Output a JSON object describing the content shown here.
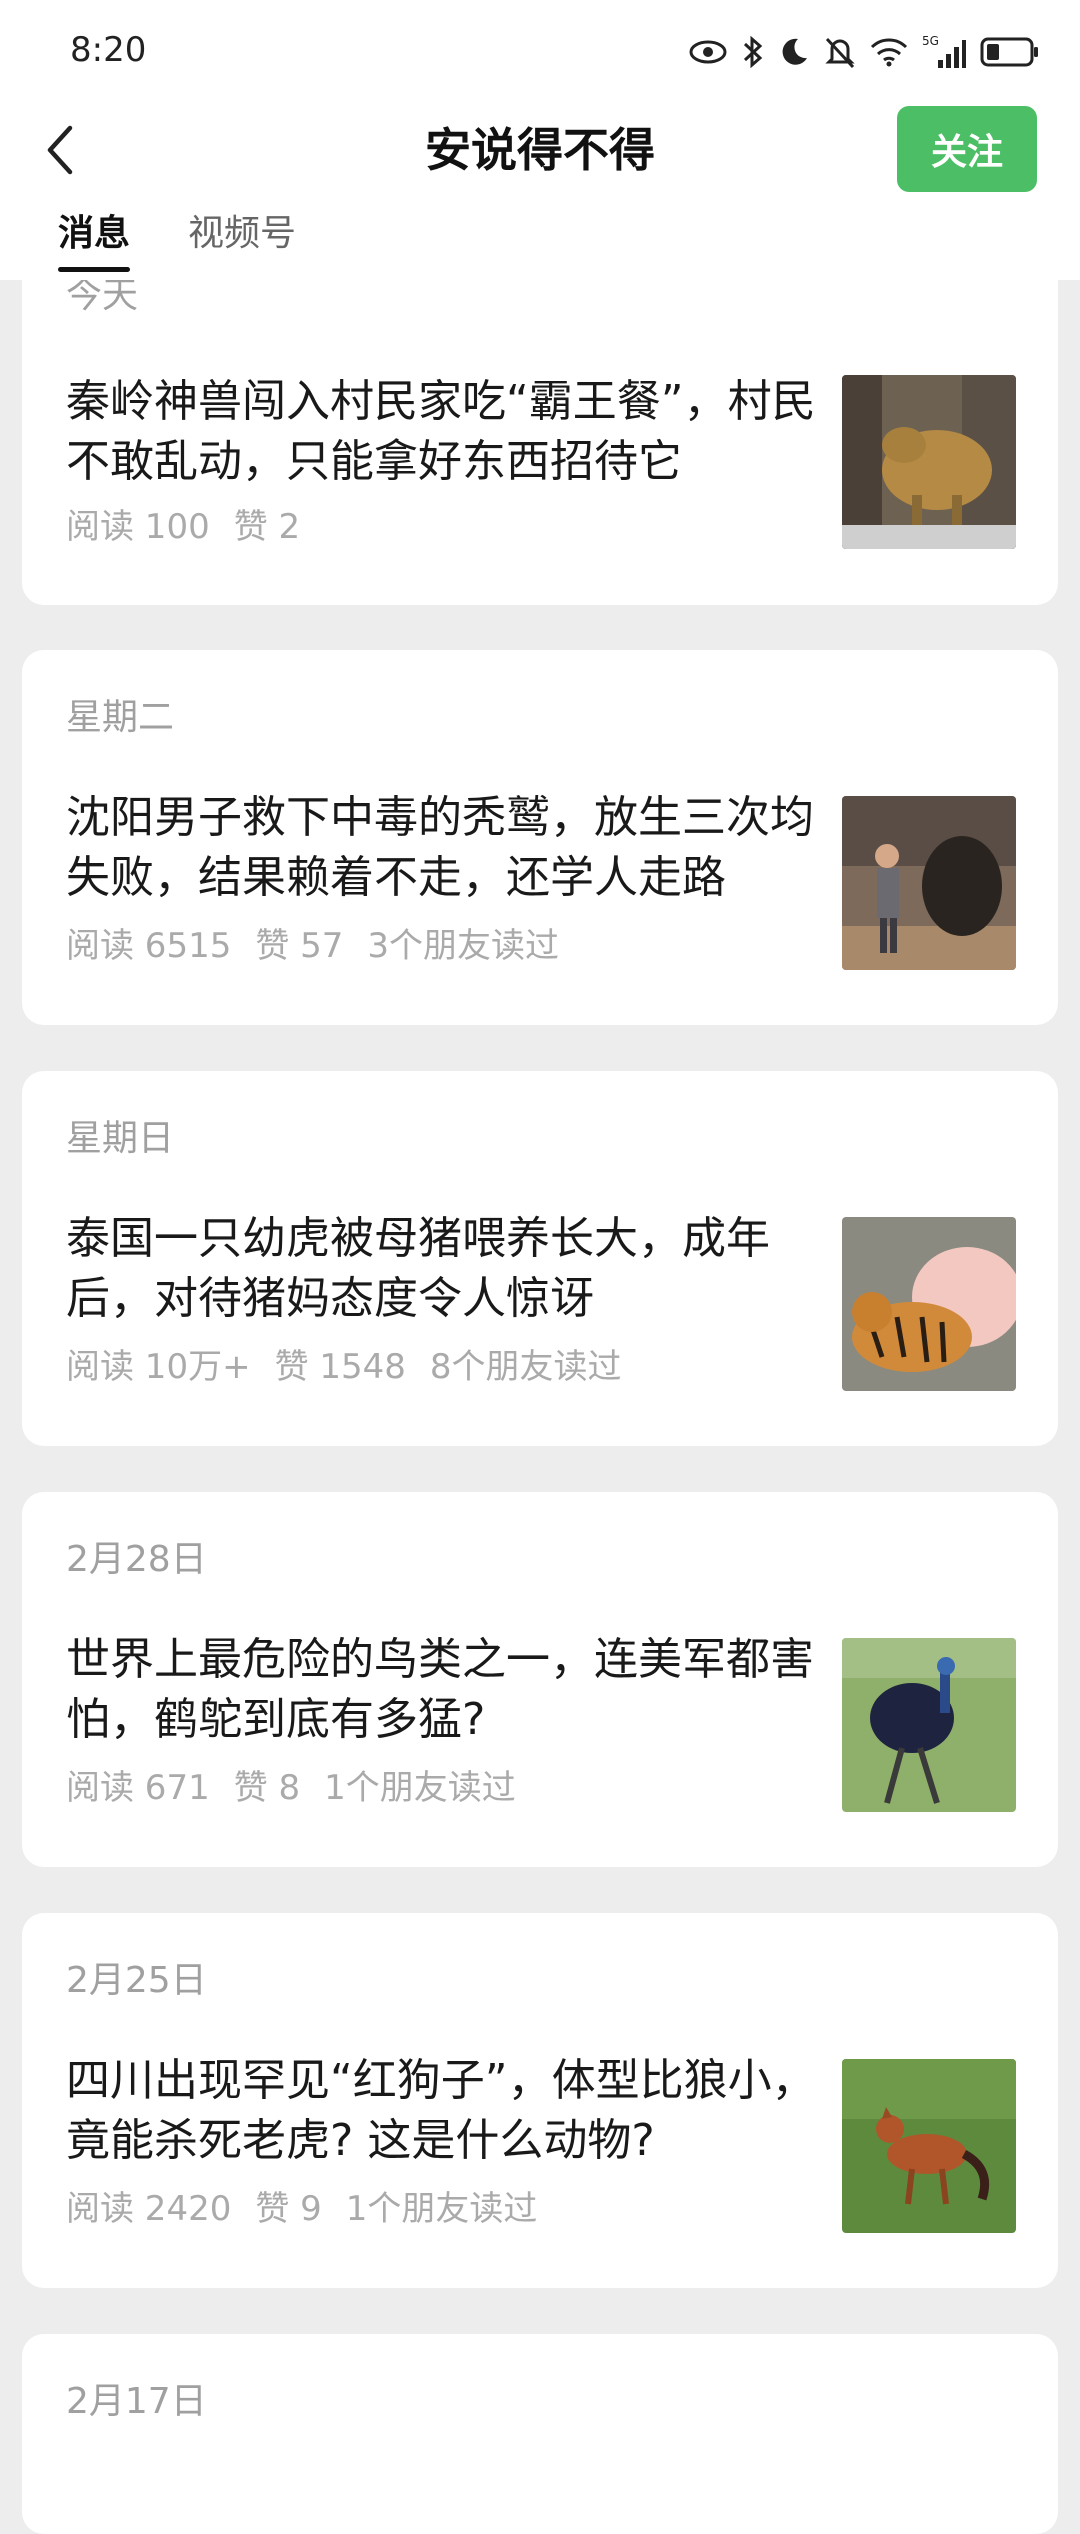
{
  "status_bar": {
    "time": "8:20",
    "network": "5G"
  },
  "header": {
    "title": "安说得不得",
    "follow_label": "关注"
  },
  "tabs": [
    {
      "label": "消息",
      "active": true
    },
    {
      "label": "视频号",
      "active": false
    }
  ],
  "articles": [
    {
      "date": "今天",
      "title": "秦岭神兽闯入村民家吃“霸王餐”，村民不敢乱动，只能拿好东西招待它",
      "reads": "阅读 100",
      "likes": "赞 2",
      "friends": "",
      "thumb": "takin"
    },
    {
      "date": "星期二",
      "title": "沈阳男子救下中毒的秃鹫，放生三次均失败，结果赖着不走，还学人走路",
      "reads": "阅读 6515",
      "likes": "赞 57",
      "friends": "3个朋友读过",
      "thumb": "vulture"
    },
    {
      "date": "星期日",
      "title": "泰国一只幼虎被母猪喂养长大，成年后，对待猪妈态度令人惊讶",
      "reads": "阅读 10万+",
      "likes": "赞 1548",
      "friends": "8个朋友读过",
      "thumb": "tiger-pig"
    },
    {
      "date": "2月28日",
      "title": "世界上最危险的鸟类之一，连美军都害怕，鹤鸵到底有多猛?",
      "reads": "阅读 671",
      "likes": "赞 8",
      "friends": "1个朋友读过",
      "thumb": "cassowary"
    },
    {
      "date": "2月25日",
      "title": "四川出现罕见“红狗子”，体型比狼小，竟能杀死老虎? 这是什么动物?",
      "reads": "阅读 2420",
      "likes": "赞 9",
      "friends": "1个朋友读过",
      "thumb": "dhole"
    },
    {
      "date": "2月17日",
      "title": "",
      "reads": "",
      "likes": "",
      "friends": "",
      "thumb": ""
    }
  ],
  "colors": {
    "accent": "#4cbf66",
    "background": "#ededed",
    "meta": "#aaaaaa"
  }
}
